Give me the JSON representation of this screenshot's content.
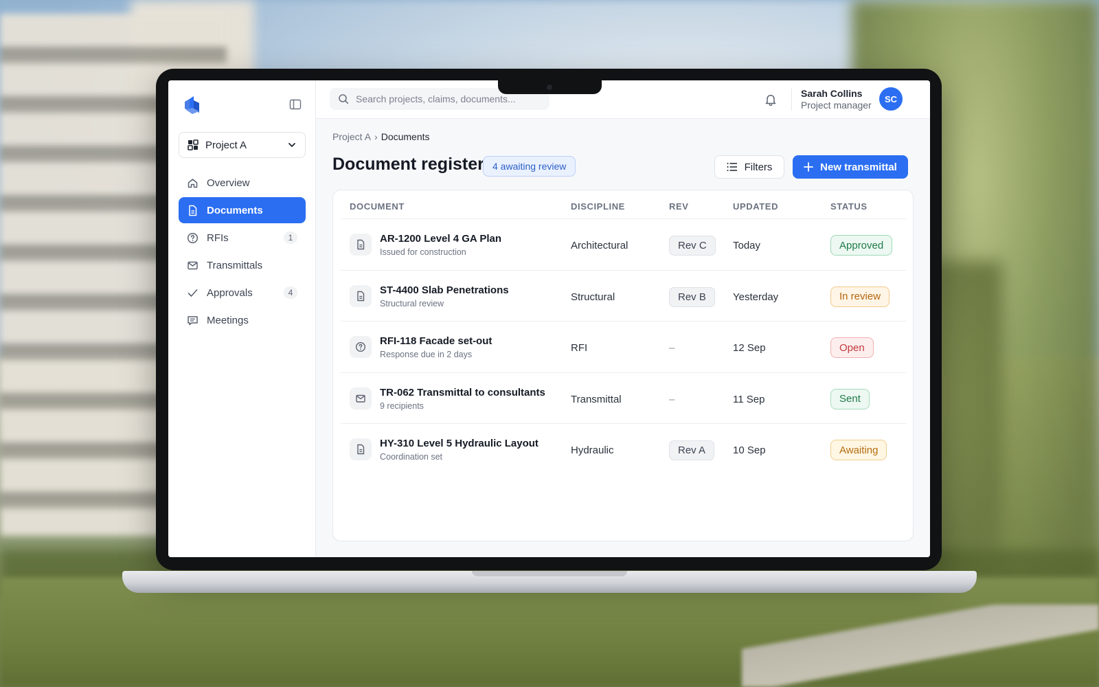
{
  "sidebar": {
    "project": "Project A",
    "items": [
      {
        "label": "Overview",
        "icon": "home-icon",
        "active": false,
        "count": ""
      },
      {
        "label": "Documents",
        "icon": "document-icon",
        "active": true,
        "count": ""
      },
      {
        "label": "RFIs",
        "icon": "question-circle-icon",
        "active": false,
        "count": "1"
      },
      {
        "label": "Transmittals",
        "icon": "mail-icon",
        "active": false,
        "count": ""
      },
      {
        "label": "Approvals",
        "icon": "check-icon",
        "active": false,
        "count": "4"
      },
      {
        "label": "Meetings",
        "icon": "chat-icon",
        "active": false,
        "count": ""
      }
    ]
  },
  "header": {
    "search_placeholder": "Search projects, claims, documents...",
    "user_name": "Sarah Collins",
    "user_role": "Project manager",
    "avatar_initials": "SC"
  },
  "main": {
    "breadcrumb": [
      "Project A",
      "Documents"
    ],
    "breadcrumb_sep": "›",
    "title": "Document register",
    "review_badge": "4 awaiting review",
    "filters_label": "Filters",
    "new_label": "New transmittal",
    "columns": [
      "DOCUMENT",
      "DISCIPLINE",
      "REV",
      "UPDATED",
      "STATUS"
    ],
    "rows": [
      {
        "title": "AR-1200 Level 4 GA Plan",
        "subtitle": "Issued for construction",
        "discipline": "Architectural",
        "rev": "Rev C",
        "updated": "Today",
        "status": "Approved",
        "status_kind": "approved",
        "icon": "document-icon"
      },
      {
        "title": "ST-4400 Slab Penetrations",
        "subtitle": "Structural review",
        "discipline": "Structural",
        "rev": "Rev B",
        "updated": "Yesterday",
        "status": "In review",
        "status_kind": "review",
        "icon": "document-icon"
      },
      {
        "title": "RFI-118 Facade set-out",
        "subtitle": "Response due in 2 days",
        "discipline": "RFI",
        "rev": "–",
        "updated": "12 Sep",
        "status": "Open",
        "status_kind": "open",
        "icon": "question-circle-icon"
      },
      {
        "title": "TR-062 Transmittal to consultants",
        "subtitle": "9 recipients",
        "discipline": "Transmittal",
        "rev": "–",
        "updated": "11 Sep",
        "status": "Sent",
        "status_kind": "sent",
        "icon": "mail-icon"
      },
      {
        "title": "HY-310 Level 5 Hydraulic Layout",
        "subtitle": "Coordination set",
        "discipline": "Hydraulic",
        "rev": "Rev A",
        "updated": "10 Sep",
        "status": "Awaiting",
        "status_kind": "awaiting",
        "icon": "document-icon"
      }
    ]
  },
  "colors": {
    "accent": "#2b6ef1",
    "status": {
      "approved": {
        "fg": "#1f7a4a",
        "bg": "#ecf8f1",
        "border": "#9fd8b7"
      },
      "review": {
        "fg": "#b5650f",
        "bg": "#fff5e6",
        "border": "#f2c989"
      },
      "open": {
        "fg": "#c23a3a",
        "bg": "#fdeeee",
        "border": "#f0b0b0"
      },
      "sent": {
        "fg": "#1f7a4a",
        "bg": "#ecf8f1",
        "border": "#a7dcbd"
      },
      "awaiting": {
        "fg": "#b36d10",
        "bg": "#fff6e3",
        "border": "#f0cf8d"
      }
    }
  }
}
